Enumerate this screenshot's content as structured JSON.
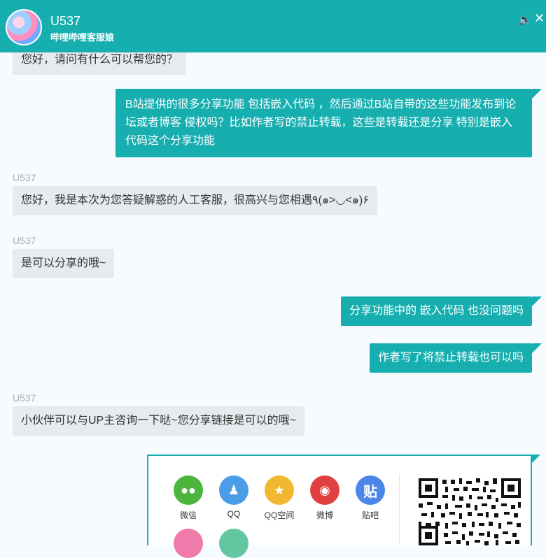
{
  "header": {
    "title": "U537",
    "subtitle": "哔哩哔哩客服娘"
  },
  "messages": [
    {
      "from": "agent",
      "sender": "",
      "text": "您好，请问有什么可以帮您的？"
    },
    {
      "from": "user",
      "text": "B站提供的很多分享功能 包括嵌入代码 ，然后通过B站自带的这些功能发布到论坛或者博客 侵权吗？比如作者写的禁止转载，这些是转载还是分享 特别是嵌入代码这个分享功能"
    },
    {
      "from": "agent",
      "sender": "U537",
      "text": "您好，我是本次为您答疑解惑的人工客服，很高兴与您相遇٩(๑>◡<๑)۶"
    },
    {
      "from": "agent",
      "sender": "U537",
      "text": "是可以分享的哦~"
    },
    {
      "from": "user",
      "text": "分享功能中的 嵌入代码 也没问题吗"
    },
    {
      "from": "user",
      "text": "作者写了将禁止转载也可以吗"
    },
    {
      "from": "agent",
      "sender": "U537",
      "text": "小伙伴可以与UP主咨询一下哒~您分享链接是可以的哦~"
    }
  ],
  "share": {
    "items": [
      {
        "label": "微信",
        "icon": "wechat-icon",
        "glyph": "●●",
        "color": "#4bb53e"
      },
      {
        "label": "QQ",
        "icon": "qq-icon",
        "glyph": "♟",
        "color": "#4a9de6"
      },
      {
        "label": "QQ空间",
        "icon": "qzone-icon",
        "glyph": "★",
        "color": "#f2b731"
      },
      {
        "label": "微博",
        "icon": "weibo-icon",
        "glyph": "◉",
        "color": "#e0403f"
      },
      {
        "label": "贴吧",
        "icon": "tieba-icon",
        "glyph": "贴",
        "color": "#4a87e8"
      }
    ],
    "more_colors": [
      "#f07aa9",
      "#62c7a0"
    ]
  }
}
